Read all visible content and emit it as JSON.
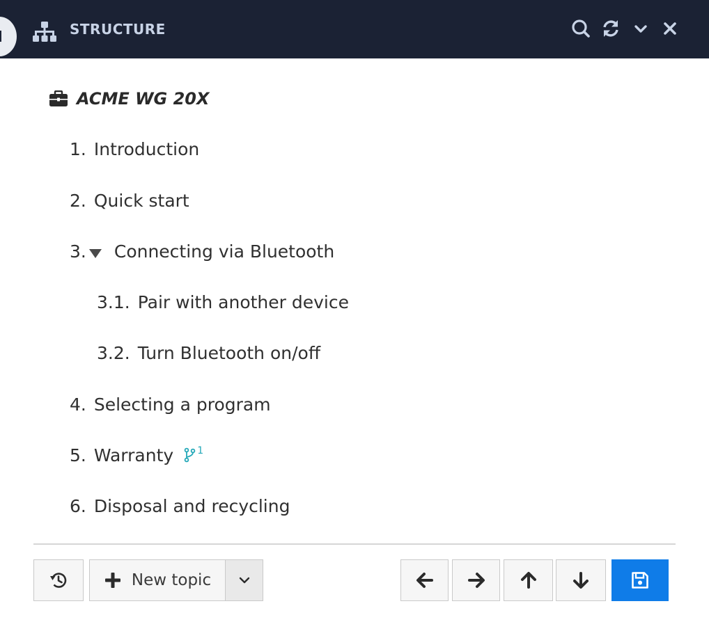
{
  "panel": {
    "title": "STRUCTURE",
    "icons": [
      "structure-icon",
      "search-icon",
      "refresh-icon",
      "chevron-down-icon",
      "close-icon"
    ]
  },
  "tree": {
    "root_label": "ACME WG 20X",
    "root_icon": "briefcase-icon",
    "items": [
      {
        "num": "1.",
        "label": "Introduction"
      },
      {
        "num": "2.",
        "label": "Quick start"
      },
      {
        "num": "3.",
        "label": "Connecting via Bluetooth",
        "expanded": true
      },
      {
        "num": "3.1.",
        "label": "Pair with another device"
      },
      {
        "num": "3.2.",
        "label": "Turn Bluetooth on/off"
      },
      {
        "num": "4.",
        "label": "Selecting a program"
      },
      {
        "num": "5.",
        "label": "Warranty",
        "branch_count": "1"
      },
      {
        "num": "6.",
        "label": "Disposal and recycling"
      }
    ]
  },
  "footer": {
    "new_topic_label": "New topic",
    "icons": [
      "history-icon",
      "plus-icon",
      "chevron-down-icon",
      "arrow-left-icon",
      "arrow-right-icon",
      "arrow-up-icon",
      "arrow-down-icon",
      "save-icon"
    ]
  },
  "colors": {
    "header_bg": "#1b2234",
    "header_text": "#c8d3e6",
    "accent_blue": "#0f7ce8",
    "branch_teal": "#24a8b8"
  }
}
